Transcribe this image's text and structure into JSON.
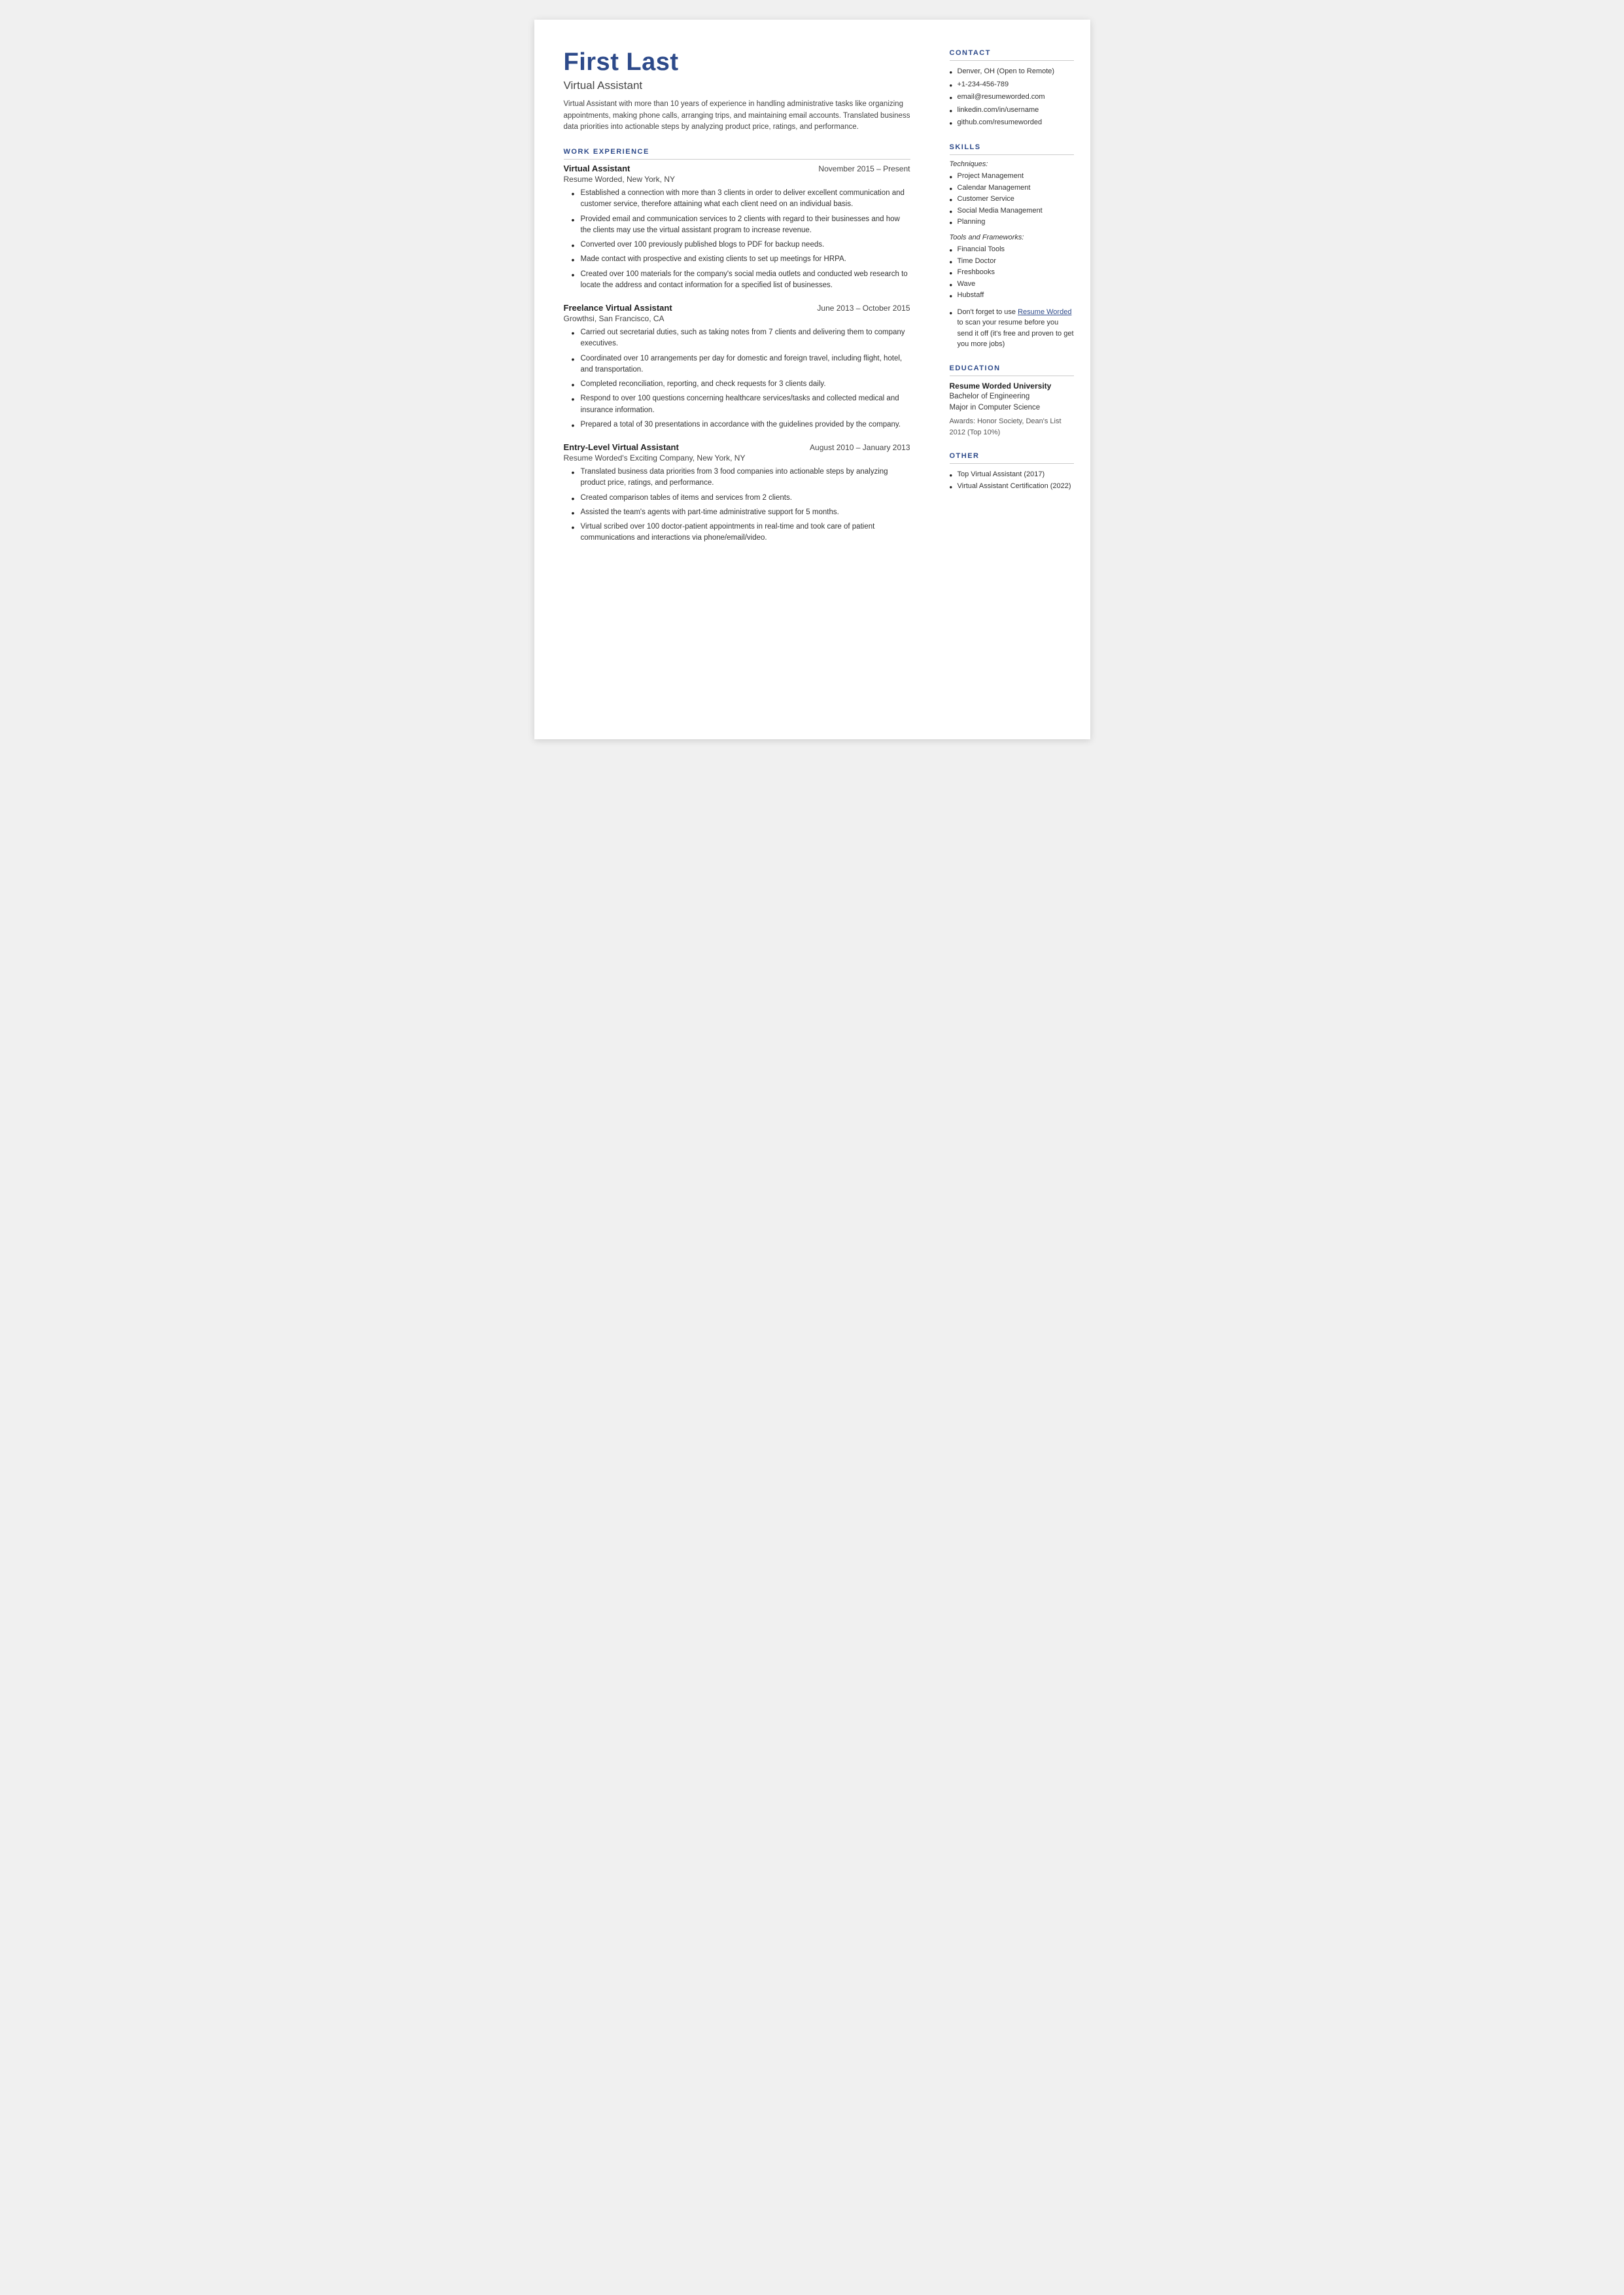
{
  "header": {
    "name": "First Last",
    "job_title": "Virtual Assistant",
    "summary": "Virtual Assistant with more than 10 years of experience in handling administrative tasks like organizing appointments, making phone calls, arranging trips, and maintaining email accounts. Translated business data priorities into actionable steps by analyzing product price, ratings, and performance."
  },
  "sections": {
    "work_experience_label": "WORK EXPERIENCE",
    "jobs": [
      {
        "title": "Virtual Assistant",
        "dates": "November 2015 – Present",
        "company": "Resume Worded, New York, NY",
        "bullets": [
          "Established a connection with more than 3 clients in order to deliver excellent communication and customer service, therefore attaining what each client need on an individual basis.",
          "Provided email and communication services to 2 clients with regard to their businesses and how the clients may use the virtual assistant program to increase revenue.",
          "Converted over 100 previously published blogs to PDF for backup needs.",
          "Made contact with prospective and existing clients to set up meetings for HRPA.",
          "Created over 100 materials for the company's social media outlets and conducted web research to locate the address and contact information for a specified list of businesses."
        ]
      },
      {
        "title": "Freelance Virtual Assistant",
        "dates": "June 2013 – October 2015",
        "company": "Growthsi, San Francisco, CA",
        "bullets": [
          "Carried out secretarial duties, such as taking notes from 7 clients and delivering them to company executives.",
          "Coordinated over 10 arrangements per day for domestic and foreign travel, including flight, hotel, and transportation.",
          "Completed reconciliation, reporting, and check requests for 3 clients daily.",
          "Respond to over 100 questions concerning healthcare services/tasks and collected medical and insurance information.",
          "Prepared a total of 30 presentations in accordance with the guidelines provided by the company."
        ]
      },
      {
        "title": "Entry-Level Virtual Assistant",
        "dates": "August 2010 – January 2013",
        "company": "Resume Worded's Exciting Company, New York, NY",
        "bullets": [
          "Translated business data priorities from 3 food companies into actionable steps by analyzing product price, ratings, and performance.",
          "Created comparison tables of items and services from 2 clients.",
          "Assisted the team's agents with part-time administrative support for 5 months.",
          "Virtual scribed over 100 doctor-patient appointments in real-time and took care of patient communications and interactions via phone/email/video."
        ]
      }
    ]
  },
  "sidebar": {
    "contact_label": "CONTACT",
    "contact_items": [
      "Denver, OH (Open to Remote)",
      "+1-234-456-789",
      "email@resumeworded.com",
      "linkedin.com/in/username",
      "github.com/resumeworded"
    ],
    "skills_label": "SKILLS",
    "techniques_label": "Techniques:",
    "techniques": [
      "Project Management",
      "Calendar Management",
      "Customer Service",
      "Social Media Management",
      "Planning"
    ],
    "tools_label": "Tools and Frameworks:",
    "tools": [
      "Financial Tools",
      "Time Doctor",
      "Freshbooks",
      "Wave",
      "Hubstaff"
    ],
    "skills_note_prefix": "Don't forget to use ",
    "skills_note_link_text": "Resume Worded",
    "skills_note_suffix": " to scan your resume before you send it off (it's free and proven to get you more jobs)",
    "education_label": "EDUCATION",
    "edu_school": "Resume Worded University",
    "edu_degree_line1": "Bachelor of Engineering",
    "edu_degree_line2": "Major in Computer Science",
    "edu_awards": "Awards: Honor Society, Dean's List 2012 (Top 10%)",
    "other_label": "OTHER",
    "other_items": [
      "Top Virtual Assistant (2017)",
      "Virtual Assistant Certification (2022)"
    ]
  }
}
